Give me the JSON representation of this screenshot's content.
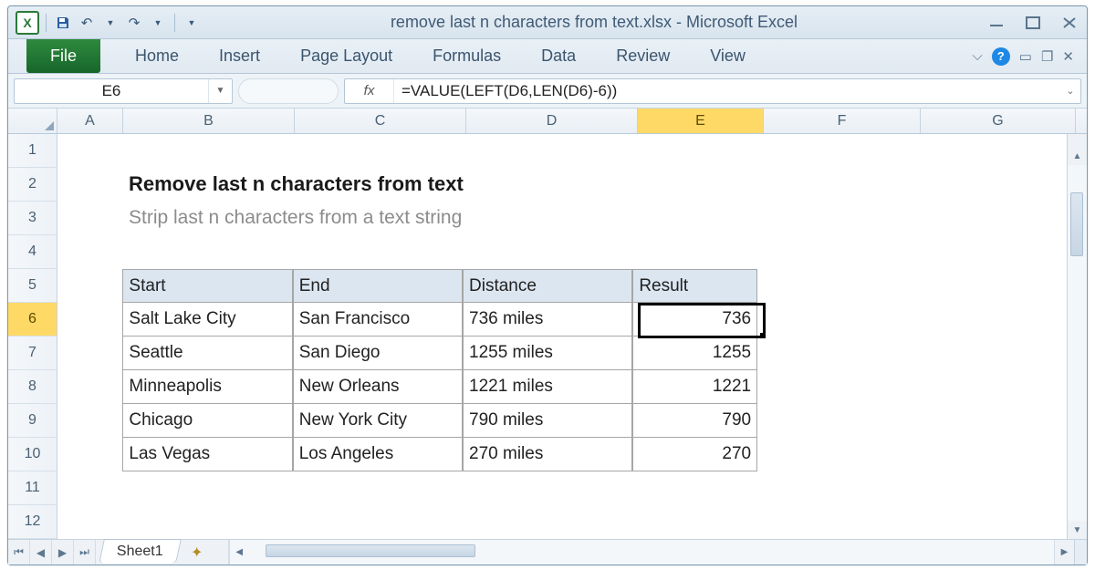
{
  "titlebar": {
    "doc_title": "remove last n characters from text.xlsx  -  Microsoft Excel",
    "excel_letter": "X"
  },
  "ribbon": {
    "file": "File",
    "tabs": [
      "Home",
      "Insert",
      "Page Layout",
      "Formulas",
      "Data",
      "Review",
      "View"
    ]
  },
  "namebox": "E6",
  "fx_label": "fx",
  "formula": "=VALUE(LEFT(D6,LEN(D6)-6))",
  "columns": [
    "A",
    "B",
    "C",
    "D",
    "E",
    "F",
    "G"
  ],
  "rows_count": 12,
  "active": {
    "col": "E",
    "row": 6
  },
  "content": {
    "title": "Remove last n characters from text",
    "subtitle": "Strip last n characters from a text string"
  },
  "table": {
    "headers": [
      "Start",
      "End",
      "Distance",
      "Result"
    ],
    "rows": [
      {
        "start": "Salt Lake City",
        "end": "San Francisco",
        "distance": "736 miles",
        "result": "736"
      },
      {
        "start": "Seattle",
        "end": "San Diego",
        "distance": "1255 miles",
        "result": "1255"
      },
      {
        "start": "Minneapolis",
        "end": "New Orleans",
        "distance": "1221 miles",
        "result": "1221"
      },
      {
        "start": "Chicago",
        "end": "New York City",
        "distance": "790 miles",
        "result": "790"
      },
      {
        "start": "Las Vegas",
        "end": "Los Angeles",
        "distance": "270 miles",
        "result": "270"
      }
    ]
  },
  "sheet_tab": "Sheet1"
}
